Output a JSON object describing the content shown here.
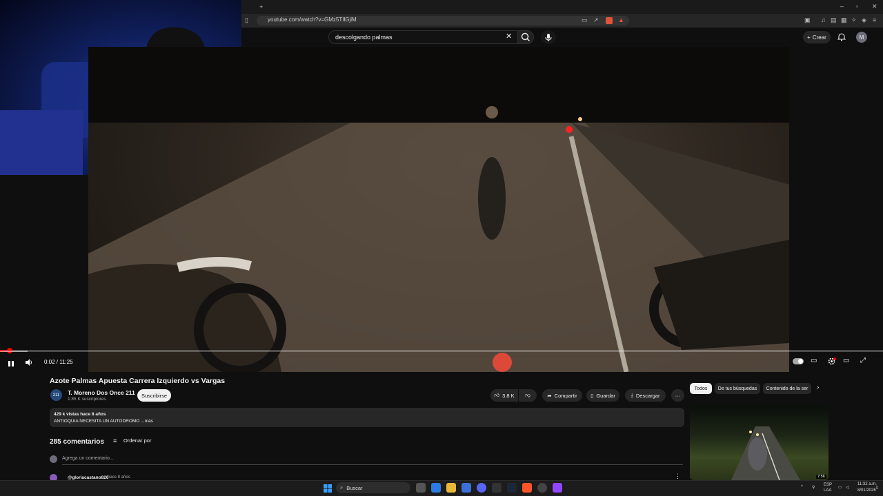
{
  "browser": {
    "url": "youtube.com/watch?v=GMz5TIlGjiM"
  },
  "header": {
    "search_value": "descolgando palmas",
    "create_label": "Crear",
    "avatar_letter": "M"
  },
  "player": {
    "time": "0:02 / 11:25",
    "progress_fraction": 0.003
  },
  "video": {
    "title": "Azote Palmas Apuesta Carrera Izquierdo vs Vargas",
    "channel": "T. Moreno Dos Once 211",
    "subscribers": "1.85 K suscriptores",
    "subscribe_label": "Suscribirse",
    "likes": "3.8 K",
    "share_label": "Compartir",
    "save_label": "Guardar",
    "download_label": "Descargar",
    "views_line": "429 k vistas  hace 8 años",
    "desc_line": "ANTIOQUIA NECESITA UN AUTODROMO ...más",
    "channel_avatar_text": "211"
  },
  "comments": {
    "count_label": "285 comentarios",
    "sort_label": "Ordenar por",
    "add_placeholder": "Agrega un comentario...",
    "first_user": "@gloriacastano826",
    "first_time": "hace 8 años"
  },
  "sidebar": {
    "chips": [
      "Todos",
      "De tus búsquedas",
      "Contenido de la ser"
    ],
    "thumb_duration": "7:56"
  },
  "taskbar": {
    "search_label": "Buscar",
    "lang_top": "ESP",
    "lang_bottom": "LAA",
    "clock_time": "11:32 a.m.",
    "clock_date": "8/01/2026"
  },
  "colors": {
    "accent": "#ff0000",
    "background": "#0f0f0f",
    "pill": "#272727"
  }
}
